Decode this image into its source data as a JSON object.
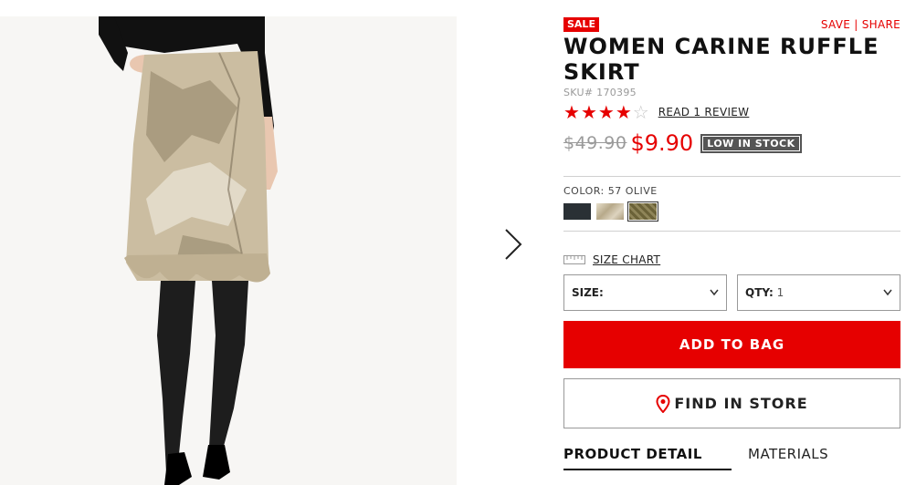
{
  "product": {
    "sale_badge": "SALE",
    "save_label": "SAVE",
    "share_separator": "|",
    "share_label": "SHARE",
    "title": "WOMEN CARINE RUFFLE SKIRT",
    "sku": "SKU# 170395",
    "rating": {
      "value": 4,
      "max": 5
    },
    "review_link": "READ 1 REVIEW",
    "old_price": "$49.90",
    "new_price": "$9.90",
    "stock_badge": "LOW IN STOCK"
  },
  "color": {
    "label": "COLOR: 57 OLIVE",
    "swatches": [
      {
        "name": "dark",
        "color": "#2a3035",
        "selected": false
      },
      {
        "name": "beige print",
        "color": "#cbbfa4",
        "selected": false
      },
      {
        "name": "olive",
        "color": "#6b6238",
        "selected": true
      }
    ]
  },
  "size_chart_label": "SIZE CHART",
  "selects": {
    "size_label": "SIZE:",
    "size_value": "",
    "qty_label": "QTY:",
    "qty_value": "1"
  },
  "buttons": {
    "add_to_bag": "ADD TO BAG",
    "find_in_store": "FIND IN STORE"
  },
  "tabs": {
    "product_detail": "PRODUCT DETAIL",
    "materials": "MATERIALS"
  },
  "icons": {
    "next": "chevron-right-icon",
    "ruler": "ruler-icon",
    "location": "location-pin-icon",
    "chevron": "chevron-down-icon"
  },
  "colors": {
    "accent": "#e60000",
    "stock_badge": "#555555"
  }
}
